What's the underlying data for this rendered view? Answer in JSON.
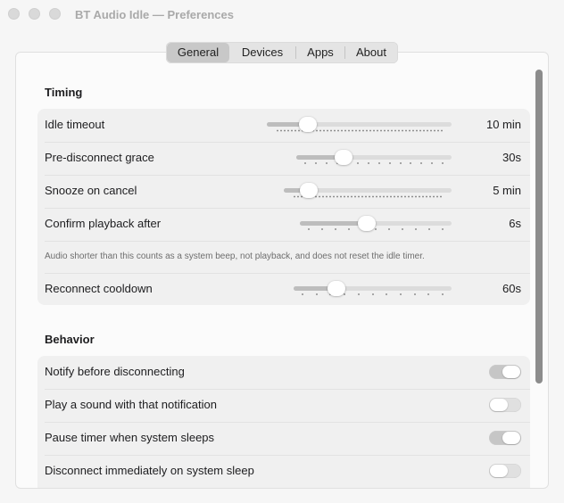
{
  "window": {
    "title": "BT Audio Idle — Preferences"
  },
  "tabs": [
    {
      "label": "General",
      "active": true
    },
    {
      "label": "Devices",
      "active": false
    },
    {
      "label": "Apps",
      "active": false
    },
    {
      "label": "About",
      "active": false
    }
  ],
  "timing": {
    "title": "Timing",
    "rows": [
      {
        "label": "Idle timeout",
        "value": "10 min",
        "level": 0.19
      },
      {
        "label": "Pre-disconnect grace",
        "value": "30s",
        "level": 0.28
      },
      {
        "label": "Snooze on cancel",
        "value": "5 min",
        "level": 0.11
      },
      {
        "label": "Confirm playback after",
        "value": "6s",
        "level": 0.43
      },
      {
        "label": "Reconnect cooldown",
        "value": "60s",
        "level": 0.24
      }
    ],
    "note": "Audio shorter than this counts as a system beep, not playback, and does not reset the idle timer."
  },
  "behavior": {
    "title": "Behavior",
    "rows": [
      {
        "label": "Notify before disconnecting",
        "on": true
      },
      {
        "label": "Play a sound with that notification",
        "on": false
      },
      {
        "label": "Pause timer when system sleeps",
        "on": true
      },
      {
        "label": "Disconnect immediately on system sleep",
        "on": false
      }
    ]
  },
  "colors": {
    "tab_active": "#c8c8c8",
    "toggle_on": "#c6c6c6",
    "toggle_off": "#e0e0e0",
    "scroll_thumb": "#8c8c8c"
  }
}
